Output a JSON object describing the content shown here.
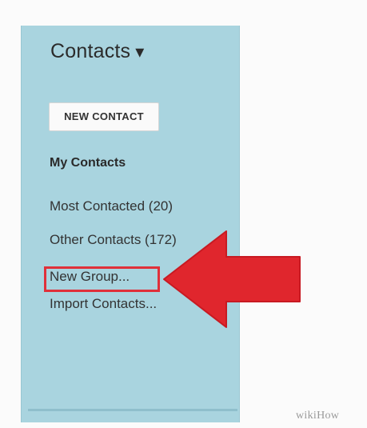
{
  "sidebar": {
    "title": "Contacts",
    "title_caret": "▾",
    "new_contact_label": "NEW CONTACT",
    "items": [
      {
        "label": "My Contacts"
      },
      {
        "label": "Most Contacted (20)"
      },
      {
        "label": "Other Contacts (172)"
      },
      {
        "label": "New Group..."
      },
      {
        "label": "Import Contacts..."
      }
    ]
  },
  "annotation": {
    "highlight_color": "#e0303a",
    "arrow_icon": "left-arrow-icon"
  },
  "watermark": {
    "text": "wikiHow"
  },
  "colors": {
    "panel_bg": "#a9d4df",
    "page_bg": "#fbfbfb"
  }
}
